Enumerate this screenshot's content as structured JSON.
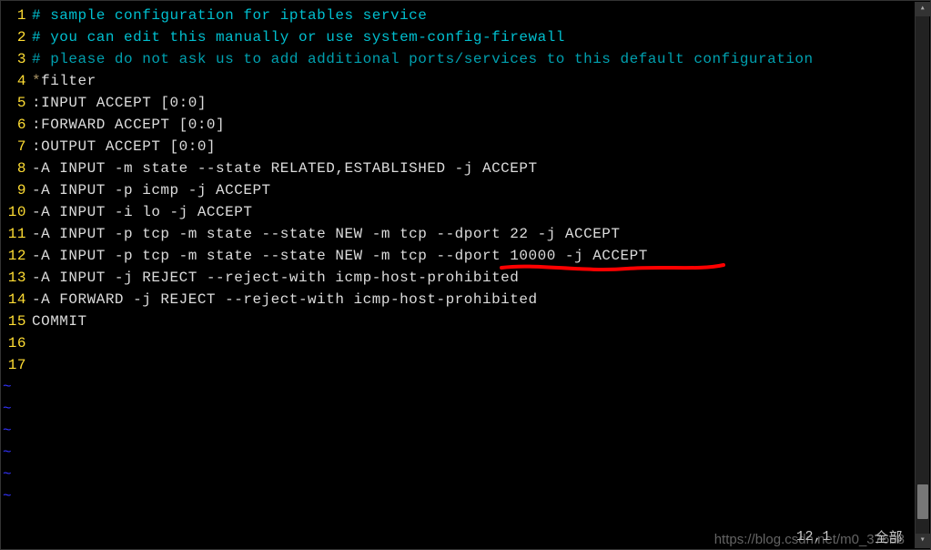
{
  "lines": [
    {
      "n": 1,
      "cls": "cm1",
      "text": "# sample configuration for iptables service"
    },
    {
      "n": 2,
      "cls": "cm1",
      "text": "# you can edit this manually or use system-config-firewall"
    },
    {
      "n": 3,
      "cls": "cm2",
      "text": "# please do not ask us to add additional ports/services to this default configuration"
    },
    {
      "n": 4,
      "cls": "code",
      "text": "*filter",
      "star": true
    },
    {
      "n": 5,
      "cls": "code",
      "text": ":INPUT ACCEPT [0:0]"
    },
    {
      "n": 6,
      "cls": "code",
      "text": ":FORWARD ACCEPT [0:0]"
    },
    {
      "n": 7,
      "cls": "code",
      "text": ":OUTPUT ACCEPT [0:0]"
    },
    {
      "n": 8,
      "cls": "code",
      "text": "-A INPUT -m state --state RELATED,ESTABLISHED -j ACCEPT"
    },
    {
      "n": 9,
      "cls": "code",
      "text": "-A INPUT -p icmp -j ACCEPT"
    },
    {
      "n": 10,
      "cls": "code",
      "text": "-A INPUT -i lo -j ACCEPT"
    },
    {
      "n": 11,
      "cls": "code",
      "text": "-A INPUT -p tcp -m state --state NEW -m tcp --dport 22 -j ACCEPT"
    },
    {
      "n": 12,
      "cls": "code",
      "text": "-A INPUT -p tcp -m state --state NEW -m tcp --dport 10000 -j ACCEPT"
    },
    {
      "n": 13,
      "cls": "code",
      "text": "-A INPUT -j REJECT --reject-with icmp-host-prohibited"
    },
    {
      "n": 14,
      "cls": "code",
      "text": "-A FORWARD -j REJECT --reject-with icmp-host-prohibited"
    },
    {
      "n": 15,
      "cls": "code",
      "text": "COMMIT"
    },
    {
      "n": 16,
      "cls": "code",
      "text": ""
    },
    {
      "n": 17,
      "cls": "code",
      "text": ""
    }
  ],
  "tilde_count": 6,
  "tilde_char": "~",
  "status": {
    "pos": "12,1",
    "mode": "全部"
  },
  "watermark": "https://blog.csdn.net/m0_37698"
}
